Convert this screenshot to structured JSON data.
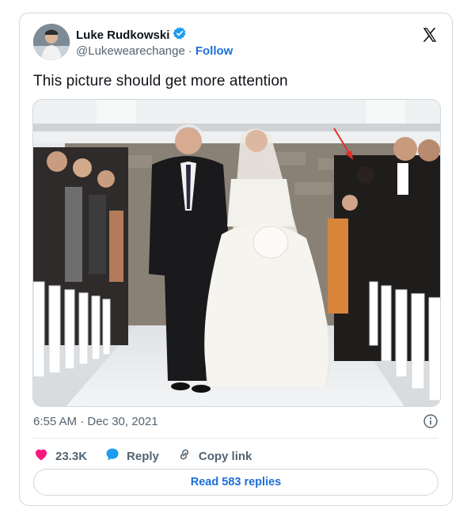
{
  "author": {
    "name": "Luke Rudkowski",
    "handle": "@Lukewearechange",
    "follow_label": "Follow"
  },
  "tweet": {
    "text": "This picture should get more attention",
    "timestamp": "6:55 AM · Dec 30, 2021"
  },
  "actions": {
    "likes": "23.3K",
    "reply_label": "Reply",
    "copy_label": "Copy link"
  },
  "read_replies_label": "Read 583 replies",
  "icons": {
    "verified": "verified-badge-icon",
    "logo": "x-logo-icon",
    "info": "info-icon",
    "like": "heart-icon",
    "reply": "speech-bubble-icon",
    "copy": "link-icon"
  },
  "colors": {
    "accent": "#1d6fd6",
    "like": "#f91880",
    "verified": "#1d9bf0",
    "annotation_arrow": "#e0302a"
  }
}
